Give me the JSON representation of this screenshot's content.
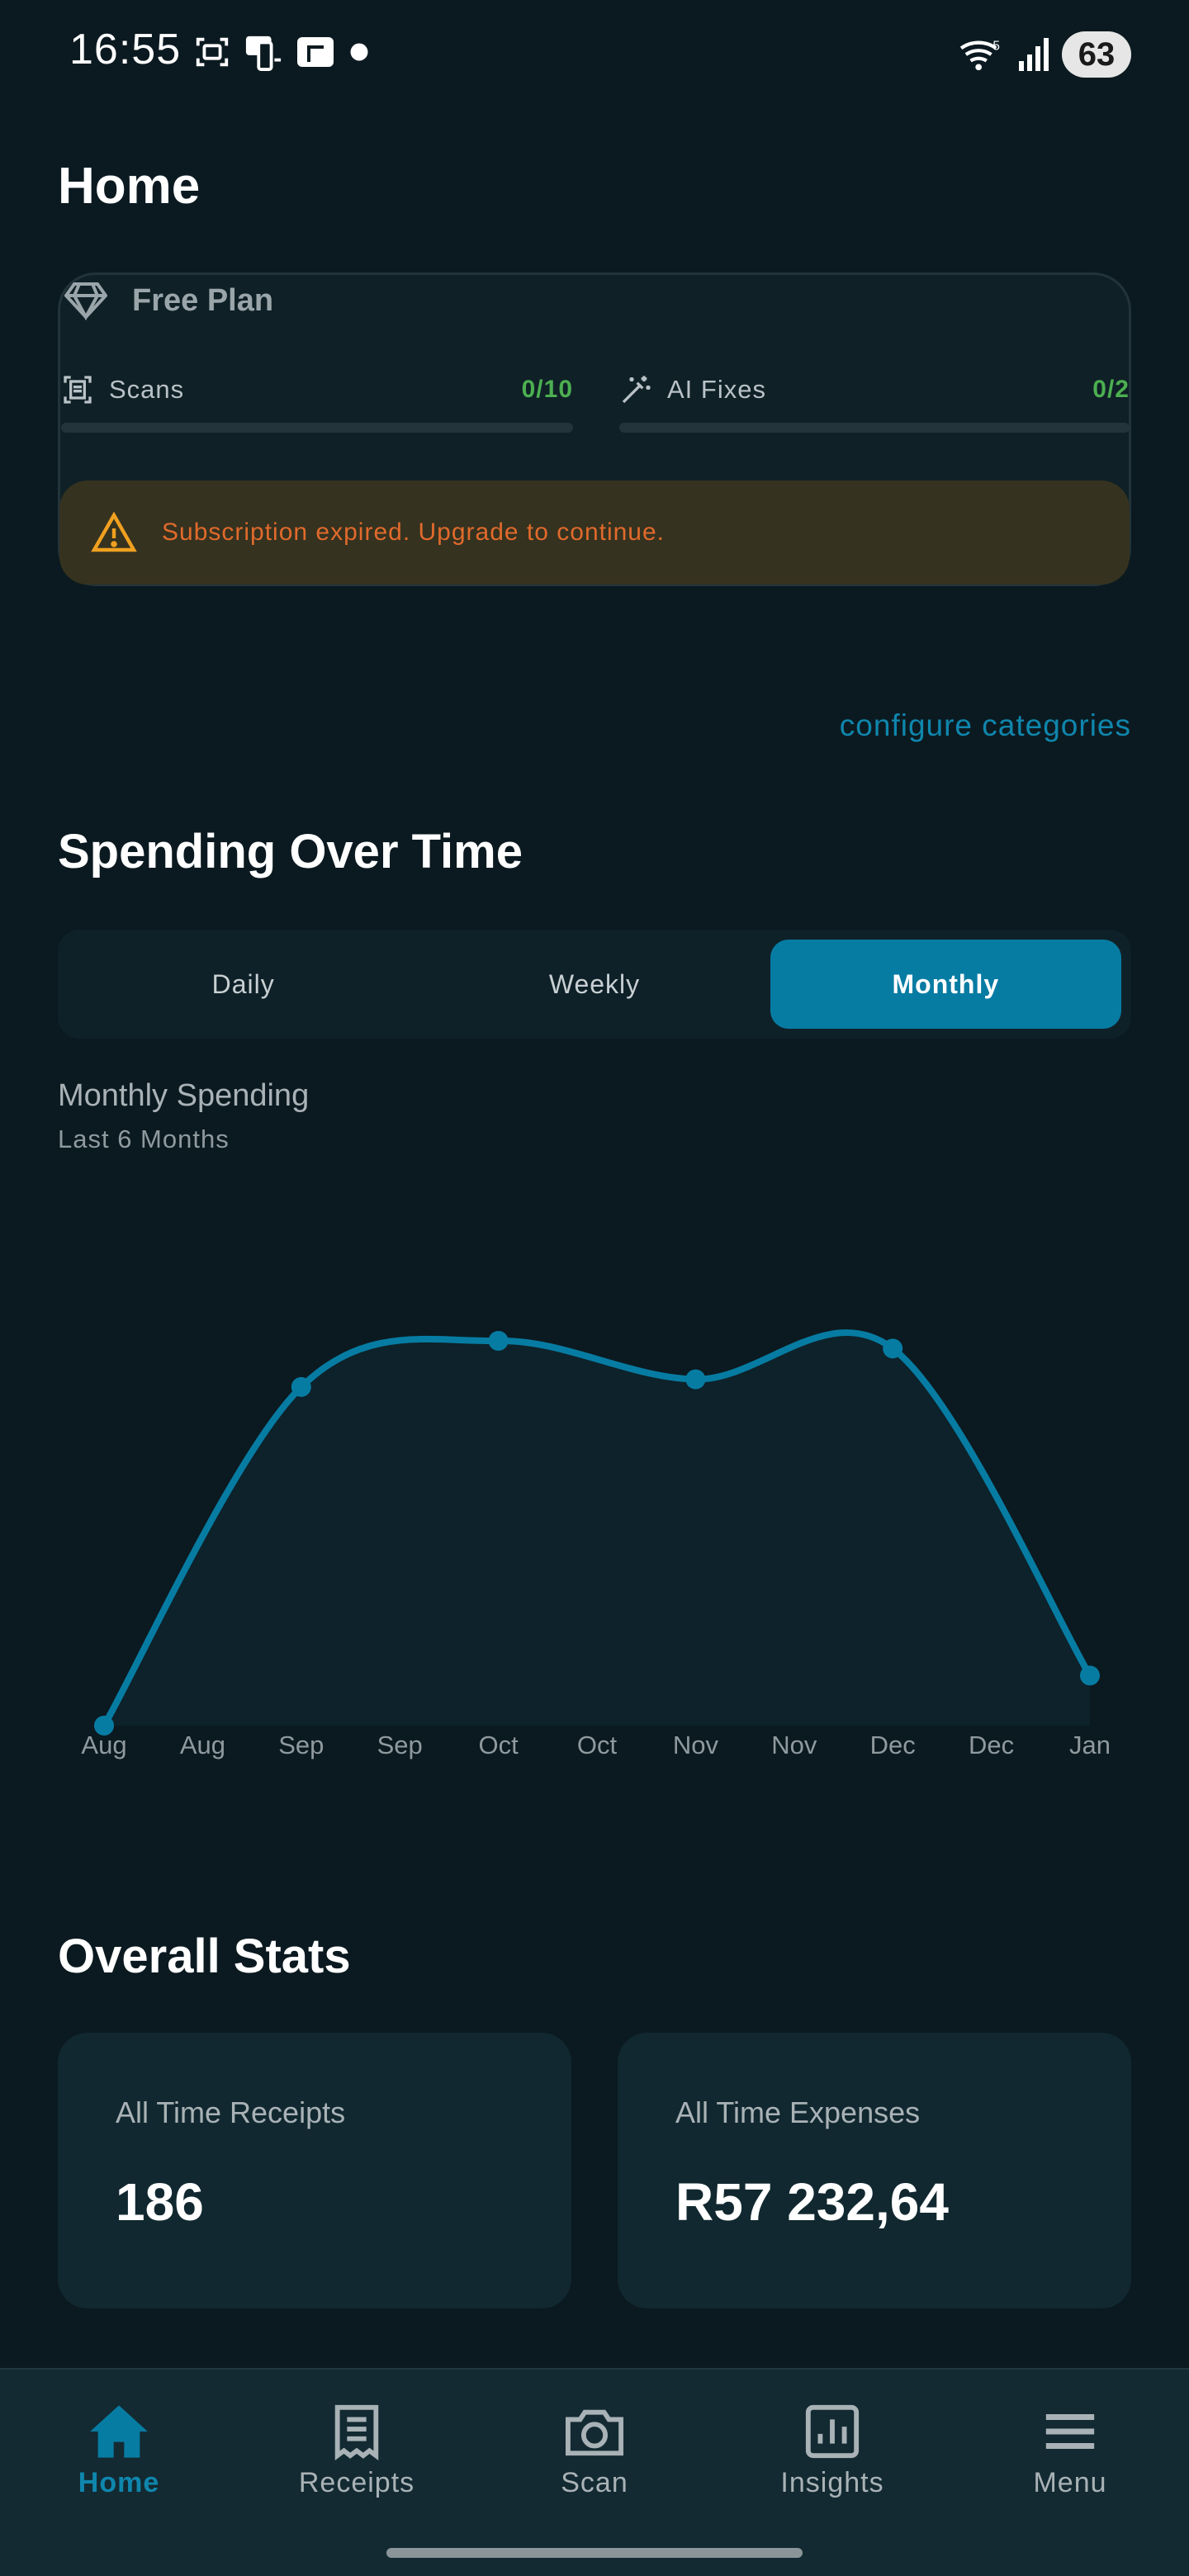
{
  "status_bar": {
    "time": "16:55",
    "battery": "63",
    "wifi_badge": "5",
    "icons": [
      "screenshot-icon",
      "phone-mirror-icon",
      "notes-icon",
      "dot-icon",
      "wifi-icon",
      "signal-icon"
    ]
  },
  "page": {
    "title": "Home"
  },
  "plan": {
    "title": "Free Plan",
    "usage": [
      {
        "label": "Scans",
        "count": "0/10",
        "used_fraction": 0
      },
      {
        "label": "AI Fixes",
        "count": "0/2",
        "used_fraction": 0
      }
    ],
    "warning": "Subscription expired. Upgrade to continue."
  },
  "configure_link": "configure categories",
  "spending": {
    "title": "Spending Over Time",
    "tabs": [
      "Daily",
      "Weekly",
      "Monthly"
    ],
    "active_tab": "Monthly"
  },
  "chart_data": {
    "type": "area",
    "title": "Monthly Spending",
    "subtitle": "Last 6 Months",
    "tick_labels": [
      "Aug",
      "Aug",
      "Sep",
      "Sep",
      "Oct",
      "Oct",
      "Nov",
      "Nov",
      "Dec",
      "Dec",
      "Jan"
    ],
    "categories": [
      "Aug",
      "Sep",
      "Oct",
      "Nov",
      "Dec",
      "Jan"
    ],
    "values": [
      0,
      0.88,
      1.0,
      0.9,
      0.98,
      0.13
    ],
    "value_scale": "relative (no y-axis shown)",
    "grid": false,
    "line_color": "#077ca3",
    "fill_color": "#0d222a"
  },
  "stats": {
    "title": "Overall Stats",
    "receipts_label": "All Time Receipts",
    "receipts_value": "186",
    "expenses_label": "All Time Expenses",
    "expenses_value": "R57 232,64"
  },
  "nav": {
    "items": [
      {
        "label": "Home",
        "icon": "home-icon",
        "active": true
      },
      {
        "label": "Receipts",
        "icon": "receipt-icon",
        "active": false
      },
      {
        "label": "Scan",
        "icon": "camera-icon",
        "active": false
      },
      {
        "label": "Insights",
        "icon": "insights-icon",
        "active": false
      },
      {
        "label": "Menu",
        "icon": "menu-icon",
        "active": false
      }
    ]
  },
  "colors": {
    "background": "#0b1a20",
    "accent": "#077ca3",
    "success": "#4caf50",
    "warning": "#e06a2c"
  }
}
